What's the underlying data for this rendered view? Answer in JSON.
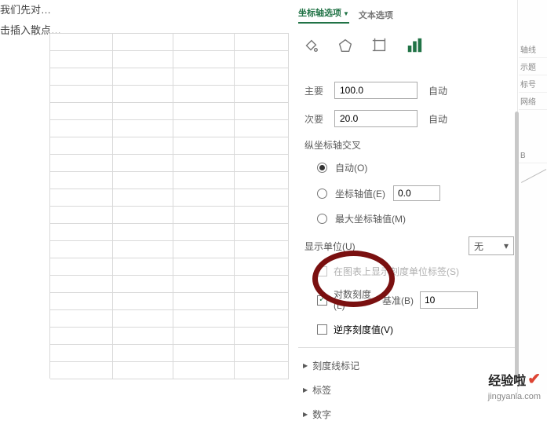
{
  "left_text": {
    "line1": "我们先对…",
    "line2": "击插入散点…"
  },
  "tabs": {
    "axis_options": "坐标轴选项",
    "text_options": "文本选项"
  },
  "icons": {
    "fill": "fill-bucket-icon",
    "effects": "pentagon-icon",
    "size": "size-properties-icon",
    "chart": "bar-chart-icon"
  },
  "units": {
    "major_label": "主要",
    "major_value": "100.0",
    "major_auto": "自动",
    "minor_label": "次要",
    "minor_value": "20.0",
    "minor_auto": "自动"
  },
  "axis_cross": {
    "title": "纵坐标轴交叉",
    "auto": "自动(O)",
    "axis_value": "坐标轴值(E)",
    "axis_value_input": "0.0",
    "max_axis_value": "最大坐标轴值(M)"
  },
  "display_units": {
    "label": "显示单位(U)",
    "value": "无",
    "caret": "▾",
    "show_on_chart": "在图表上显示刻度单位标签(S)"
  },
  "log_scale": {
    "label": "对数刻度(L)",
    "base_label": "基准(B)",
    "base_value": "10"
  },
  "reverse": {
    "label": "逆序刻度值(V)"
  },
  "expanders": {
    "tick_marks": "刻度线标记",
    "labels": "标签",
    "number": "数字"
  },
  "right_faint": {
    "a": "轴线",
    "b": "示题",
    "c": "标号",
    "d": "网络",
    "e": "B"
  },
  "watermark": {
    "text": "经验啦",
    "url": "jingyanla.com"
  }
}
